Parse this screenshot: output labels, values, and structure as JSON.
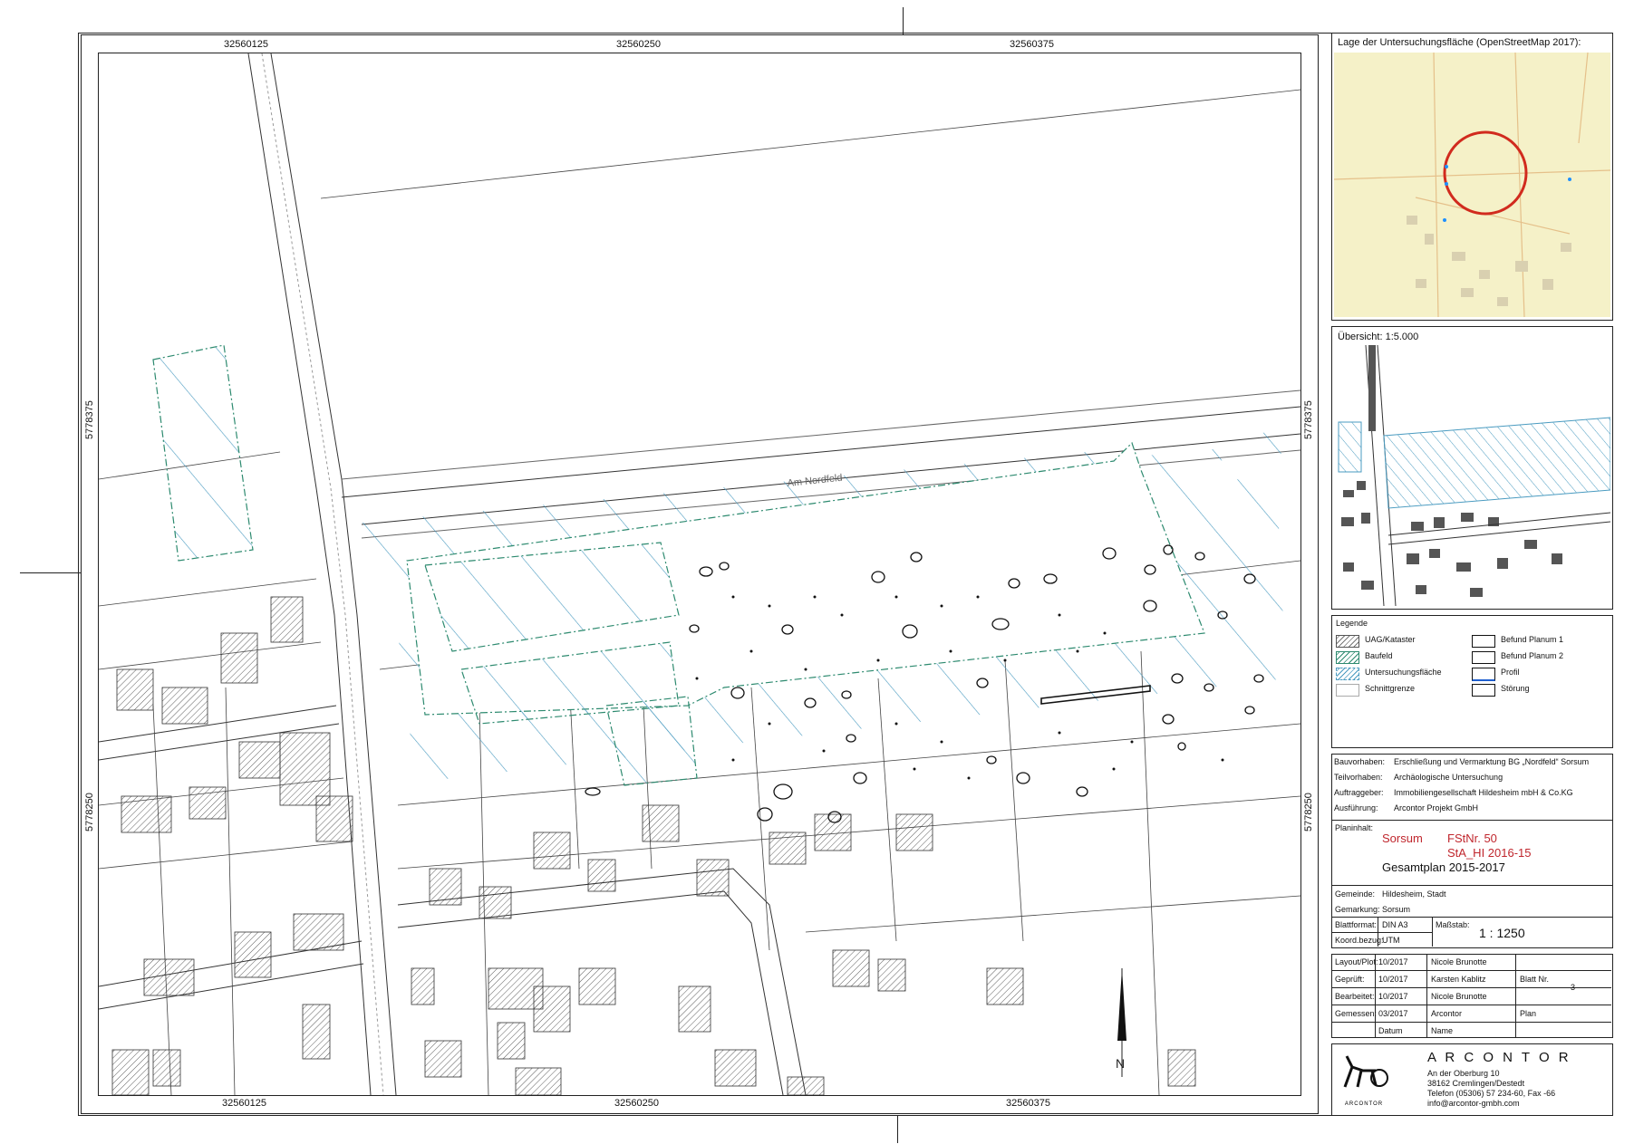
{
  "map": {
    "x_labels": [
      "32560125",
      "32560250",
      "32560375"
    ],
    "y_labels": [
      "5778375",
      "5778250"
    ],
    "street_name": "Am Nordfeld",
    "north_letter": "N"
  },
  "location_panel": {
    "title": "Lage der Untersuchungsfläche (OpenStreetMap 2017):"
  },
  "overview_panel": {
    "title": "Übersicht: 1:5.000"
  },
  "legend": {
    "title": "Legende",
    "items_left": [
      "UAG/Kataster",
      "Baufeld",
      "Untersuchungsfläche",
      "Schnittgrenze"
    ],
    "items_right": [
      "Befund Planum 1",
      "Befund Planum 2",
      "Profil",
      "Störung"
    ]
  },
  "project": {
    "rows": [
      {
        "label": "Bauvorhaben:",
        "value": "Erschließung und Vermarktung BG „Nordfeld“ Sorsum"
      },
      {
        "label": "Teilvorhaben:",
        "value": "Archäologische Untersuchung"
      },
      {
        "label": "Auftraggeber:",
        "value": "Immobiliengesellschaft Hildesheim mbH & Co.KG"
      },
      {
        "label": "Ausführung:",
        "value": "Arcontor Projekt GmbH"
      }
    ],
    "planinhalt_label": "Planinhalt:",
    "place": "Sorsum",
    "fst": "FStNr. 50",
    "sta": "StA_HI 2016-15",
    "plan_title": "Gesamtplan 2015-2017",
    "gemeinde_label": "Gemeinde:",
    "gemeinde": "Hildesheim, Stadt",
    "gemarkung_label": "Gemarkung:",
    "gemarkung": "Sorsum",
    "blattformat_label": "Blattformat:",
    "blattformat": "DIN A3",
    "massstab_label": "Maßstab:",
    "massstab": "1 : 1250",
    "koord_label": "Koord.bezug:",
    "koord": "UTM"
  },
  "credits": {
    "rows": [
      {
        "label": "Layout/Plot:",
        "date": "10/2017",
        "name": "Nicole Brunotte"
      },
      {
        "label": "Geprüft:",
        "date": "10/2017",
        "name": "Karsten Kablitz"
      },
      {
        "label": "Bearbeitet:",
        "date": "10/2017",
        "name": "Nicole Brunotte"
      },
      {
        "label": "Gemessen:",
        "date": "03/2017",
        "name": "Arcontor"
      }
    ],
    "date_header": "Datum",
    "name_header": "Name",
    "blatt_label": "Blatt Nr.",
    "blatt_value": "3",
    "plan_label": "Plan"
  },
  "company": {
    "name": "A R C O N T O R",
    "logo_text": "ARCONTOR",
    "address": [
      "An der Oberburg 10",
      "38162 Cremlingen/Destedt",
      "Telefon (05306) 57 234-60, Fax -66",
      "info@arcontor-gmbh.com"
    ]
  }
}
